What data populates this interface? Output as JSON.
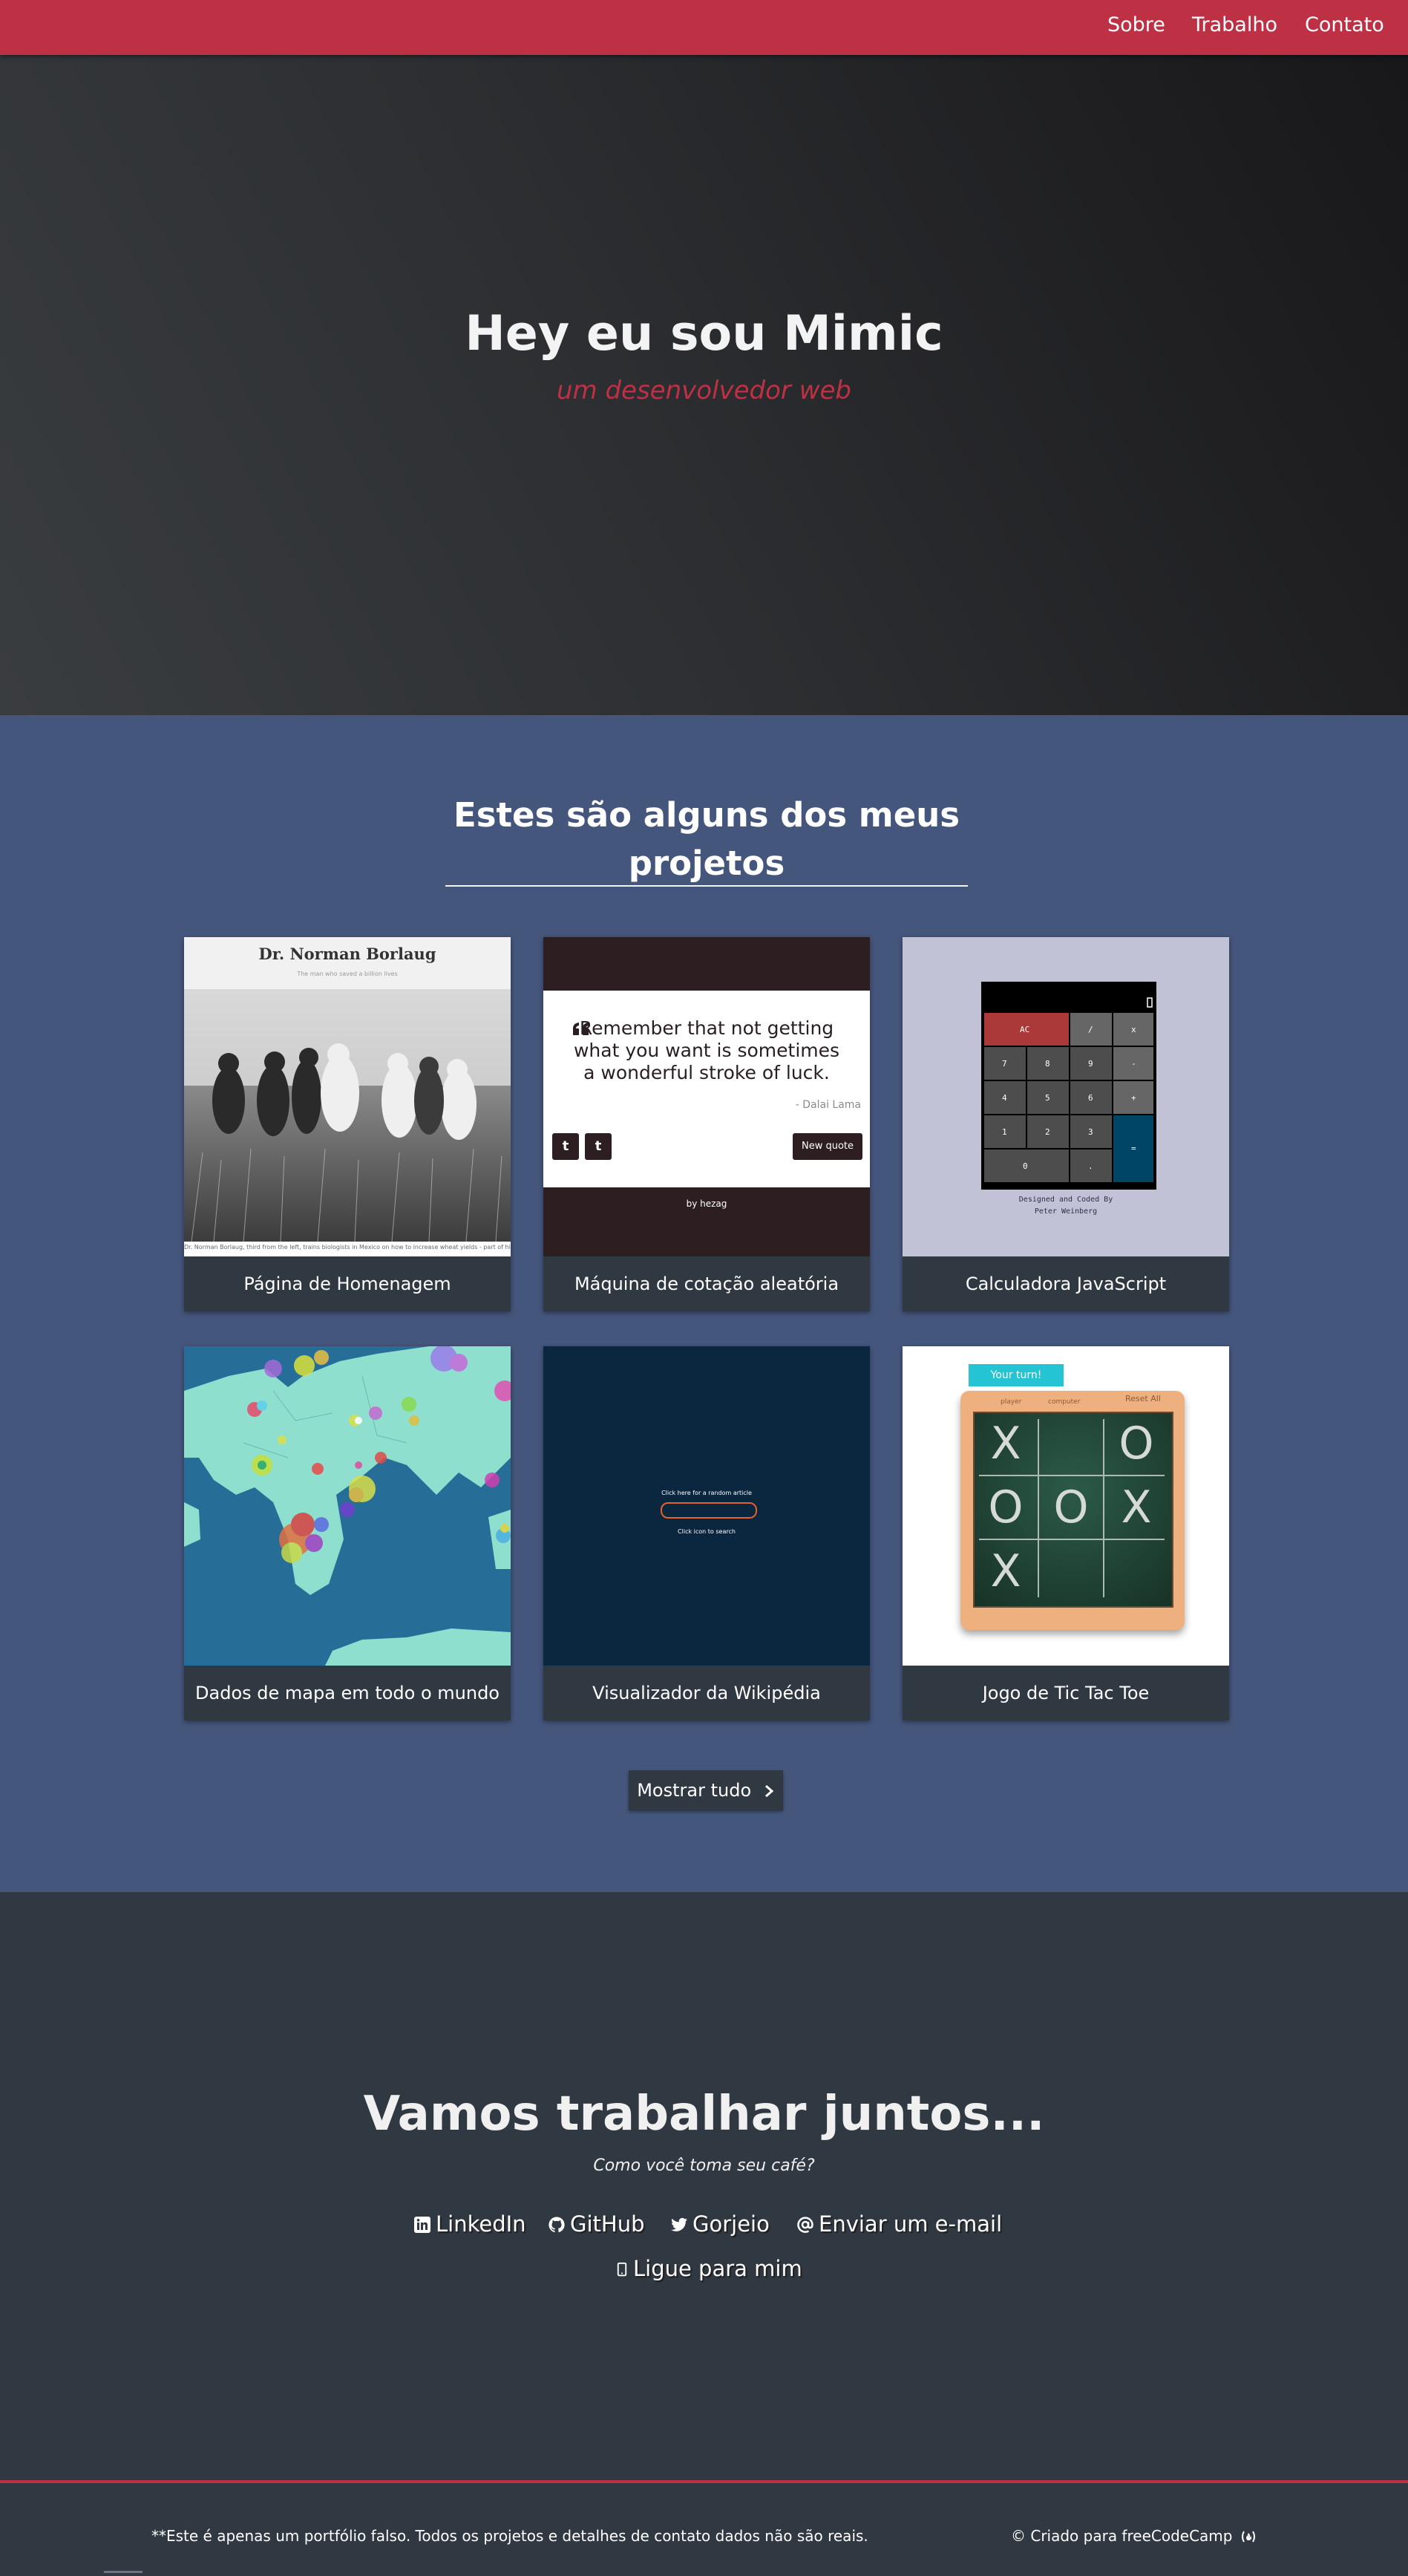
{
  "nav": {
    "items": [
      {
        "label": "Sobre"
      },
      {
        "label": "Trabalho"
      },
      {
        "label": "Contato"
      }
    ]
  },
  "hero": {
    "title": "Hey eu sou Mimic",
    "subtitle": "um desenvolvedor web"
  },
  "projects": {
    "heading_line1": "Estes são alguns dos meus",
    "heading_line2": "projetos",
    "tiles": [
      {
        "label": "Página de Homenagem",
        "preview": {
          "title": "Dr. Norman Borlaug",
          "tagline": "The man who saved a billion lives",
          "caption": "Dr. Norman Borlaug, third from the left, trains biologists in Mexico on how to increase wheat yields - part of his life-long war on hunger."
        }
      },
      {
        "label": "Máquina de cotação aleatória",
        "preview": {
          "quote": "Remember that not getting what you want is sometimes a wonderful stroke of luck.",
          "author": "- Dalai Lama",
          "button": "New quote",
          "twitter": "t",
          "tumblr": "t",
          "credit": "by hezag"
        }
      },
      {
        "label": "Calculadora JavaScript",
        "preview": {
          "keys": [
            "AC",
            "/",
            "x",
            "7",
            "8",
            "9",
            "-",
            "4",
            "5",
            "6",
            "+",
            "1",
            "2",
            "3",
            "=",
            "0",
            "."
          ],
          "credit_line1": "Designed and Coded By",
          "credit_line2": "Peter Weinberg"
        }
      },
      {
        "label": "Dados de mapa em todo o mundo"
      },
      {
        "label": "Visualizador da Wikipédia",
        "preview": {
          "random_link": "Click here for a random article",
          "search_hint": "Click icon to search"
        }
      },
      {
        "label": "Jogo de Tic Tac Toe",
        "preview": {
          "turn": "Your turn!",
          "player": "player",
          "computer": "computer",
          "reset": "Reset All",
          "board": [
            "X",
            "",
            "O",
            "O",
            "O",
            "X",
            "X",
            "",
            ""
          ]
        }
      }
    ],
    "show_all": "Mostrar tudo"
  },
  "contact": {
    "title": "Vamos trabalhar juntos...",
    "subtitle": "Como você toma seu café?",
    "links": [
      {
        "label": "LinkedIn",
        "icon": "linkedin-icon"
      },
      {
        "label": "GitHub",
        "icon": "github-icon"
      },
      {
        "label": "Gorjeio",
        "icon": "twitter-icon"
      },
      {
        "label": "Enviar um e-mail",
        "icon": "at-icon"
      },
      {
        "label": "Ligue para mim",
        "icon": "mobile-phone-icon"
      }
    ]
  },
  "footer": {
    "disclaimer": "**Este é apenas um portfólio falso. Todos os projetos e detalhes de contato dados não são reais.",
    "credit": "© Criado para freeCodeCamp",
    "credit_icon": "freecodecamp-icon"
  },
  "colors": {
    "accent": "#be3144",
    "projects_bg": "#45567d",
    "dark_bg": "#303841",
    "text_light": "#f3f3f3"
  }
}
